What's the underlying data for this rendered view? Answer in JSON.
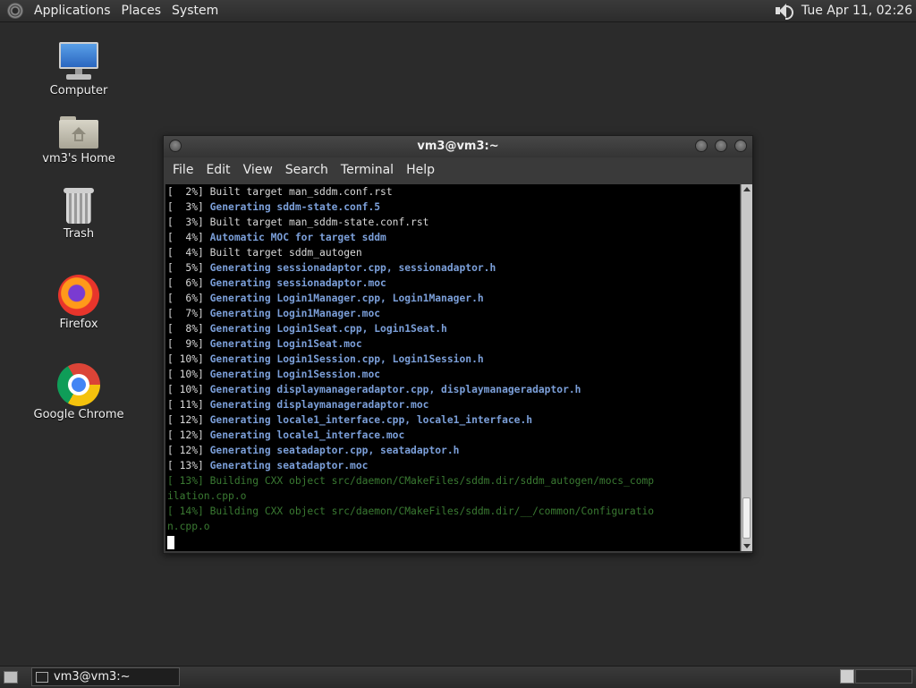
{
  "top_panel": {
    "menus": [
      "Applications",
      "Places",
      "System"
    ],
    "clock": "Tue Apr 11, 02:26"
  },
  "desktop_icons": [
    {
      "label": "Computer",
      "icon": "computer-icon"
    },
    {
      "label": "vm3's Home",
      "icon": "home-folder-icon"
    },
    {
      "label": "Trash",
      "icon": "trash-icon"
    },
    {
      "label": "Firefox",
      "icon": "firefox-icon"
    },
    {
      "label": "Google Chrome",
      "icon": "chrome-icon"
    }
  ],
  "terminal": {
    "title": "vm3@vm3:~",
    "menus": [
      "File",
      "Edit",
      "View",
      "Search",
      "Terminal",
      "Help"
    ],
    "lines": [
      {
        "prefix": "[  2%] ",
        "text": "Built target man_sddm.conf.rst",
        "style": "white"
      },
      {
        "prefix": "[  3%] ",
        "text": "Generating sddm-state.conf.5",
        "style": "blue"
      },
      {
        "prefix": "[  3%] ",
        "text": "Built target man_sddm-state.conf.rst",
        "style": "white"
      },
      {
        "prefix": "[  4%] ",
        "text": "Automatic MOC for target sddm",
        "style": "blue"
      },
      {
        "prefix": "[  4%] ",
        "text": "Built target sddm_autogen",
        "style": "white"
      },
      {
        "prefix": "[  5%] ",
        "text": "Generating sessionadaptor.cpp, sessionadaptor.h",
        "style": "blue"
      },
      {
        "prefix": "[  6%] ",
        "text": "Generating sessionadaptor.moc",
        "style": "blue"
      },
      {
        "prefix": "[  6%] ",
        "text": "Generating Login1Manager.cpp, Login1Manager.h",
        "style": "blue"
      },
      {
        "prefix": "[  7%] ",
        "text": "Generating Login1Manager.moc",
        "style": "blue"
      },
      {
        "prefix": "[  8%] ",
        "text": "Generating Login1Seat.cpp, Login1Seat.h",
        "style": "blue"
      },
      {
        "prefix": "[  9%] ",
        "text": "Generating Login1Seat.moc",
        "style": "blue"
      },
      {
        "prefix": "[ 10%] ",
        "text": "Generating Login1Session.cpp, Login1Session.h",
        "style": "blue"
      },
      {
        "prefix": "[ 10%] ",
        "text": "Generating Login1Session.moc",
        "style": "blue"
      },
      {
        "prefix": "[ 10%] ",
        "text": "Generating displaymanageradaptor.cpp, displaymanageradaptor.h",
        "style": "blue"
      },
      {
        "prefix": "[ 11%] ",
        "text": "Generating displaymanageradaptor.moc",
        "style": "blue"
      },
      {
        "prefix": "[ 12%] ",
        "text": "Generating locale1_interface.cpp, locale1_interface.h",
        "style": "blue"
      },
      {
        "prefix": "[ 12%] ",
        "text": "Generating locale1_interface.moc",
        "style": "blue"
      },
      {
        "prefix": "[ 12%] ",
        "text": "Generating seatadaptor.cpp, seatadaptor.h",
        "style": "blue"
      },
      {
        "prefix": "[ 13%] ",
        "text": "Generating seatadaptor.moc",
        "style": "blue"
      },
      {
        "prefix": "[ 13%] ",
        "text": "Building CXX object src/daemon/CMakeFiles/sddm.dir/sddm_autogen/mocs_comp",
        "style": "green"
      },
      {
        "prefix": "",
        "text": "ilation.cpp.o",
        "style": "green"
      },
      {
        "prefix": "[ 14%] ",
        "text": "Building CXX object src/daemon/CMakeFiles/sddm.dir/__/common/Configuratio",
        "style": "green"
      },
      {
        "prefix": "",
        "text": "n.cpp.o",
        "style": "green"
      }
    ]
  },
  "taskbar": {
    "task_label": "vm3@vm3:~"
  }
}
